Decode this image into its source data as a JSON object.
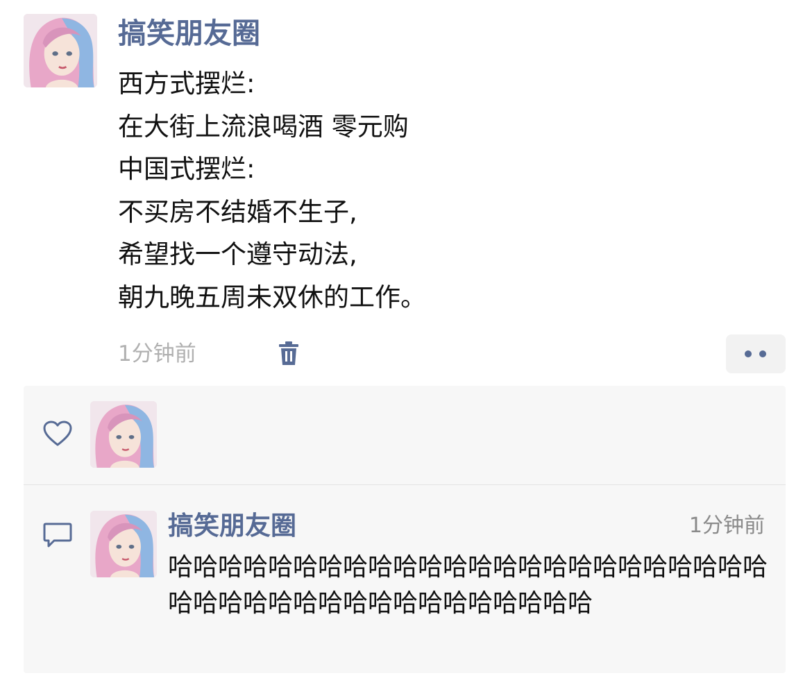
{
  "post": {
    "author": "搞笑朋友圈",
    "lines": [
      "西方式摆烂:",
      "在大街上流浪喝酒 零元购",
      "中国式摆烂:",
      "不买房不结婚不生子,",
      "希望找一个遵守动法,",
      "朝九晚五周未双休的工作。"
    ],
    "time": "1分钟前",
    "delete_icon": "trash-icon",
    "more_icon": "more-dots-icon"
  },
  "likes": {
    "icon": "heart-icon"
  },
  "comment": {
    "icon": "comment-icon",
    "author": "搞笑朋友圈",
    "time": "1分钟前",
    "text": "哈哈哈哈哈哈哈哈哈哈哈哈哈哈哈哈哈哈哈哈哈哈哈哈哈哈哈哈哈哈哈哈哈哈哈哈哈哈哈哈哈"
  },
  "colors": {
    "name_blue": "#566a95",
    "text_dark": "#111111",
    "time_gray": "#b0b0b0",
    "panel_bg": "#f7f7f7"
  }
}
